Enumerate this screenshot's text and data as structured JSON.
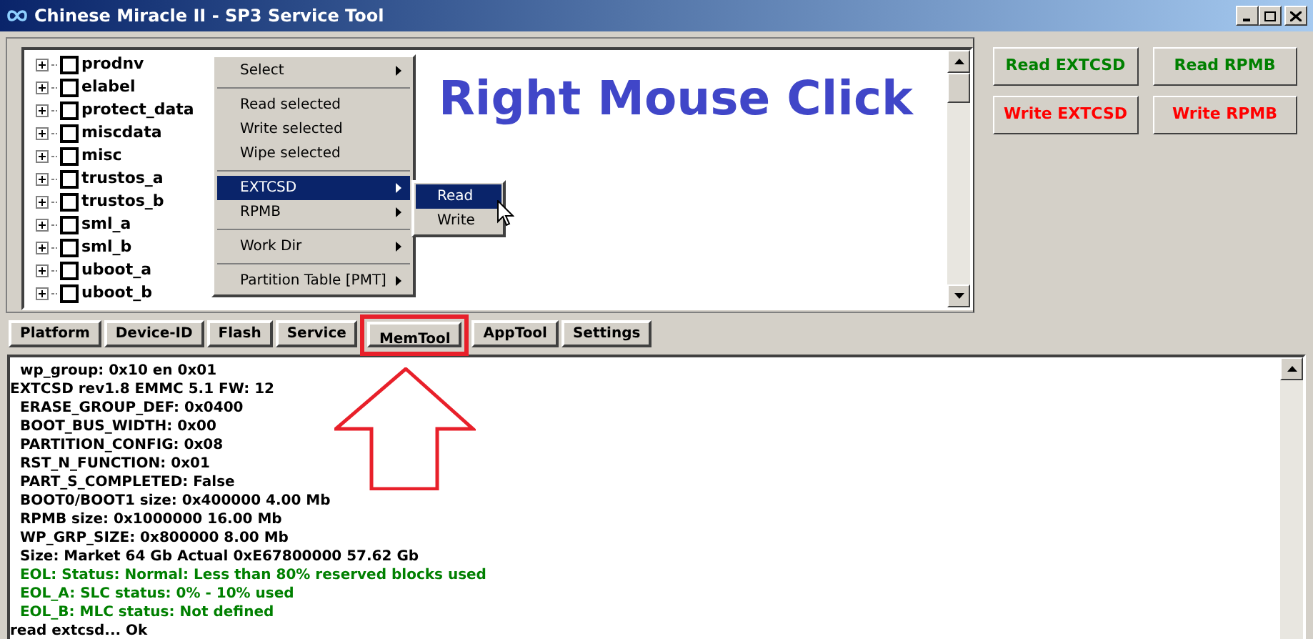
{
  "window": {
    "title": "Chinese Miracle II - SP3 Service Tool"
  },
  "tree": [
    {
      "label": "prodnv",
      "checked": false
    },
    {
      "label": "elabel",
      "checked": false
    },
    {
      "label": "protect_data",
      "checked": false
    },
    {
      "label": "miscdata",
      "checked": false
    },
    {
      "label": "misc",
      "checked": false
    },
    {
      "label": "trustos_a",
      "checked": false
    },
    {
      "label": "trustos_b",
      "checked": false
    },
    {
      "label": "sml_a",
      "checked": false
    },
    {
      "label": "sml_b",
      "checked": false
    },
    {
      "label": "uboot_a",
      "checked": false
    },
    {
      "label": "uboot_b",
      "checked": false
    }
  ],
  "context_menu": {
    "groups": [
      [
        {
          "label": "Select",
          "submenu": true,
          "selected": false
        }
      ],
      [
        {
          "label": "Read selected",
          "submenu": false,
          "selected": false
        },
        {
          "label": "Write selected",
          "submenu": false,
          "selected": false
        },
        {
          "label": "Wipe selected",
          "submenu": false,
          "selected": false
        }
      ],
      [
        {
          "label": "EXTCSD",
          "submenu": true,
          "selected": true
        },
        {
          "label": "RPMB",
          "submenu": true,
          "selected": false
        }
      ],
      [
        {
          "label": "Work Dir",
          "submenu": true,
          "selected": false
        }
      ],
      [
        {
          "label": "Partition Table [PMT]",
          "submenu": true,
          "selected": false
        }
      ]
    ],
    "submenu": [
      {
        "label": "Read",
        "selected": true
      },
      {
        "label": "Write",
        "selected": false
      }
    ]
  },
  "annotation": {
    "caption": "Right Mouse Click"
  },
  "buttons": [
    {
      "label": "Read EXTCSD",
      "color": "#008000"
    },
    {
      "label": "Read RPMB",
      "color": "#008000"
    },
    {
      "label": "Write EXTCSD",
      "color": "#ff0000"
    },
    {
      "label": "Write RPMB",
      "color": "#ff0000"
    }
  ],
  "tabs": [
    {
      "label": "Platform",
      "selected": false
    },
    {
      "label": "Device-ID",
      "selected": false
    },
    {
      "label": "Flash",
      "selected": false
    },
    {
      "label": "Service",
      "selected": false
    },
    {
      "label": "MemTool",
      "selected": true
    },
    {
      "label": "AppTool",
      "selected": false
    },
    {
      "label": "Settings",
      "selected": false
    }
  ],
  "log": [
    {
      "text": "  wp_group: 0x10 en 0x01",
      "color": "#000000"
    },
    {
      "text": "EXTCSD rev1.8 EMMC 5.1 FW: 12",
      "color": "#000000"
    },
    {
      "text": "  ERASE_GROUP_DEF: 0x0400",
      "color": "#000000"
    },
    {
      "text": "  BOOT_BUS_WIDTH: 0x00",
      "color": "#000000"
    },
    {
      "text": "  PARTITION_CONFIG: 0x08",
      "color": "#000000"
    },
    {
      "text": "  RST_N_FUNCTION: 0x01",
      "color": "#000000"
    },
    {
      "text": "  PART_S_COMPLETED: False",
      "color": "#000000"
    },
    {
      "text": "  BOOT0/BOOT1 size: 0x400000 4.00 Mb",
      "color": "#000000"
    },
    {
      "text": "  RPMB size: 0x1000000 16.00 Mb",
      "color": "#000000"
    },
    {
      "text": "  WP_GRP_SIZE: 0x800000 8.00 Mb",
      "color": "#000000"
    },
    {
      "text": "  Size: Market 64 Gb Actual 0xE67800000 57.62 Gb",
      "color": "#000000"
    },
    {
      "text": "  EOL: Status: Normal: Less than 80% reserved blocks used",
      "color": "#008000"
    },
    {
      "text": "  EOL_A: SLC status: 0% - 10% used",
      "color": "#008000"
    },
    {
      "text": "  EOL_B: MLC status: Not defined",
      "color": "#008000"
    },
    {
      "text": "read extcsd... Ok",
      "color": "#000000"
    }
  ]
}
